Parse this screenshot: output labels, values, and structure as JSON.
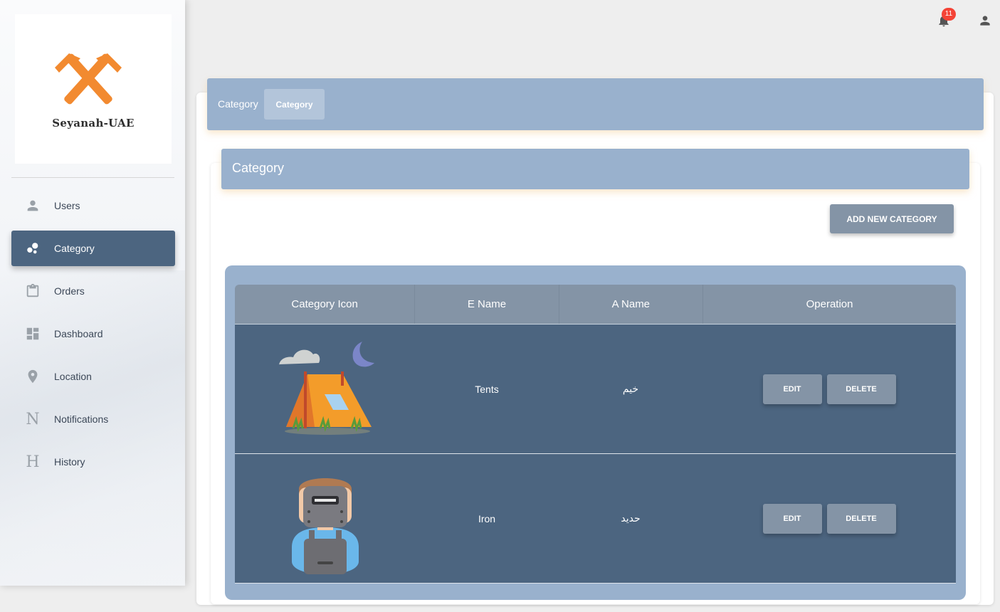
{
  "brand": {
    "name": "Seyanah-UAE",
    "accent": "#f28a30"
  },
  "sidebar": {
    "items": [
      {
        "label": "Users",
        "icon": "person-icon",
        "active": false
      },
      {
        "label": "Category",
        "icon": "bubble-chart-icon",
        "active": true
      },
      {
        "label": "Orders",
        "icon": "clipboard-icon",
        "active": false
      },
      {
        "label": "Dashboard",
        "icon": "dashboard-icon",
        "active": false
      },
      {
        "label": "Location",
        "icon": "location-pin-icon",
        "active": false
      },
      {
        "label": "Notifications",
        "icon": "N",
        "active": false
      },
      {
        "label": "History",
        "icon": "H",
        "active": false
      }
    ]
  },
  "topbar": {
    "notification_count": "11"
  },
  "breadcrumb": {
    "first": "Category",
    "current": "Category"
  },
  "section": {
    "title": "Category",
    "add_button": "ADD NEW CATEGORY"
  },
  "table": {
    "headers": [
      "Category Icon",
      "E Name",
      "A Name",
      "Operation"
    ],
    "rows": [
      {
        "icon": "tent-icon",
        "e_name": "Tents",
        "a_name": "خيم",
        "edit": "EDIT",
        "delete": "DELETE"
      },
      {
        "icon": "welder-icon",
        "e_name": "Iron",
        "a_name": "حديد",
        "edit": "EDIT",
        "delete": "DELETE"
      }
    ]
  },
  "colors": {
    "primary": "#4c6580",
    "header_bg": "#99b1cd",
    "button": "#8494a6",
    "badge": "#f44336"
  }
}
